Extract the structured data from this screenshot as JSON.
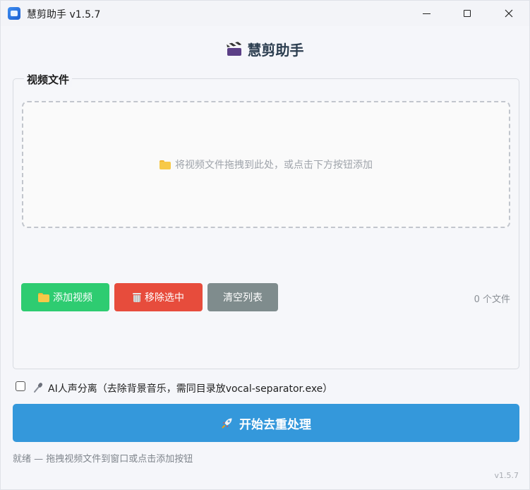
{
  "window": {
    "title": "慧剪助手 v1.5.7",
    "controls": [
      "minimize",
      "maximize",
      "close"
    ]
  },
  "header": {
    "icon": "clapper-board-icon",
    "title": "慧剪助手"
  },
  "file_group": {
    "label": "视频文件",
    "drop_hint": "将视频文件拖拽到此处，或点击下方按钮添加",
    "file_count": "0 个文件"
  },
  "buttons": {
    "add": "添加视频",
    "remove": "移除选中",
    "clear": "清空列表",
    "start": "开始去重处理"
  },
  "options": {
    "vocal_separation": {
      "label": "AI人声分离（去除背景音乐，需同目录放vocal-separator.exe）",
      "checked": false
    }
  },
  "status": {
    "text": "就绪 — 拖拽视频文件到窗口或点击添加按钮",
    "version": "v1.5.7"
  },
  "colors": {
    "add_button": "#2ecc71",
    "remove_button": "#e74c3c",
    "clear_button": "#7f8c8d",
    "start_button": "#3498db"
  }
}
